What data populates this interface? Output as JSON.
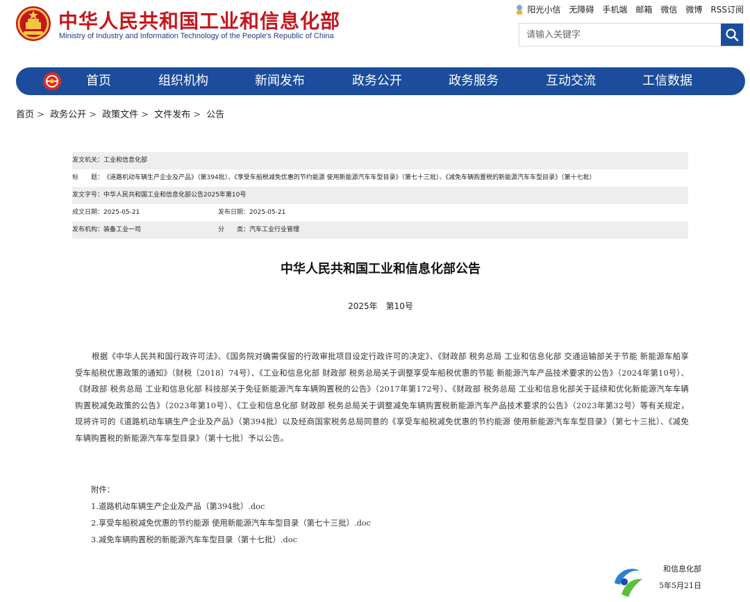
{
  "header": {
    "title": "中华人民共和国工业和信息化部",
    "subtitle": "Ministry of Industry and Information Technology of the People's Republic of China",
    "top_links": [
      "阳光小信",
      "无障碍",
      "手机端",
      "邮箱",
      "微信",
      "微博",
      "RSS订阅"
    ],
    "search_placeholder": "请输入关键字"
  },
  "nav": {
    "items": [
      "首页",
      "组织机构",
      "新闻发布",
      "政务公开",
      "政务服务",
      "互动交流",
      "工信数据"
    ]
  },
  "breadcrumb": [
    "首页",
    "政务公开",
    "政策文件",
    "文件发布",
    "公告"
  ],
  "meta": {
    "issuer_label": "发文机关：",
    "issuer": "工业和信息化部",
    "title_label": "标　　题：",
    "title": "《道路机动车辆生产企业及产品》（第394批）、《享受车船税减免优惠的节约能源 使用新能源汽车车型目录》（第七十三批）、《减免车辆购置税的新能源汽车车型目录》（第十七批）",
    "doc_no_label": "发文字号：",
    "doc_no": "中华人民共和国工业和信息化部公告2025年第10号",
    "created_label": "成文日期：",
    "created": "2025-05-21",
    "published_label": "发布日期：",
    "published": "2025-05-21",
    "agency_label": "发布机构：",
    "agency": "装备工业一司",
    "category_label": "分　　类：",
    "category": "汽车工业行业管理"
  },
  "document": {
    "title": "中华人民共和国工业和信息化部公告",
    "number": "2025年　第10号",
    "body": "根据《中华人民共和国行政许可法》、《国务院对确需保留的行政审批项目设定行政许可的决定》、《财政部 税务总局 工业和信息化部 交通运输部关于节能 新能源车船享受车船税优惠政策的通知》（财税〔2018〕74号）、《工业和信息化部 财政部 税务总局关于调整享受车船税优惠的节能 新能源汽车产品技术要求的公告》（2024年第10号）、《财政部 税务总局 工业和信息化部 科技部关于免征新能源汽车车辆购置税的公告》（2017年第172号）、《财政部 税务总局 工业和信息化部关于延续和优化新能源汽车车辆购置税减免政策的公告》（2023年第10号）、《工业和信息化部 财政部 税务总局关于调整减免车辆购置税新能源汽车产品技术要求的公告》（2023年第32号）等有关规定，现将许可的《道路机动车辆生产企业及产品》（第394批）以及经商国家税务总局同意的《享受车船税减免优惠的节约能源 使用新能源汽车车型目录》（第七十三批）、《减免车辆购置税的新能源汽车车型目录》（第十七批）予以公告。",
    "attachments_heading": "附件：",
    "attachments": [
      "1.道路机动车辆生产企业及产品（第394批）.doc",
      "2.享受车船税减免优惠的节约能源 使用新能源汽车车型目录（第七十三批）.doc",
      "3.减免车辆购置税的新能源汽车车型目录（第十七批）.doc"
    ],
    "signature_org": "和信息化部",
    "signature_date": "5年5月21日"
  },
  "colors": {
    "brand_red": "#c4161c",
    "nav_blue": "#1c4d9c",
    "meta_shade": "#eeeeee"
  },
  "icons": {
    "emblem": "national-emblem-icon",
    "search": "search-icon",
    "nav_logo": "miit-logo-icon",
    "sunshine": "sunshine-assistant-icon",
    "assistant": "assistant-float-icon"
  }
}
